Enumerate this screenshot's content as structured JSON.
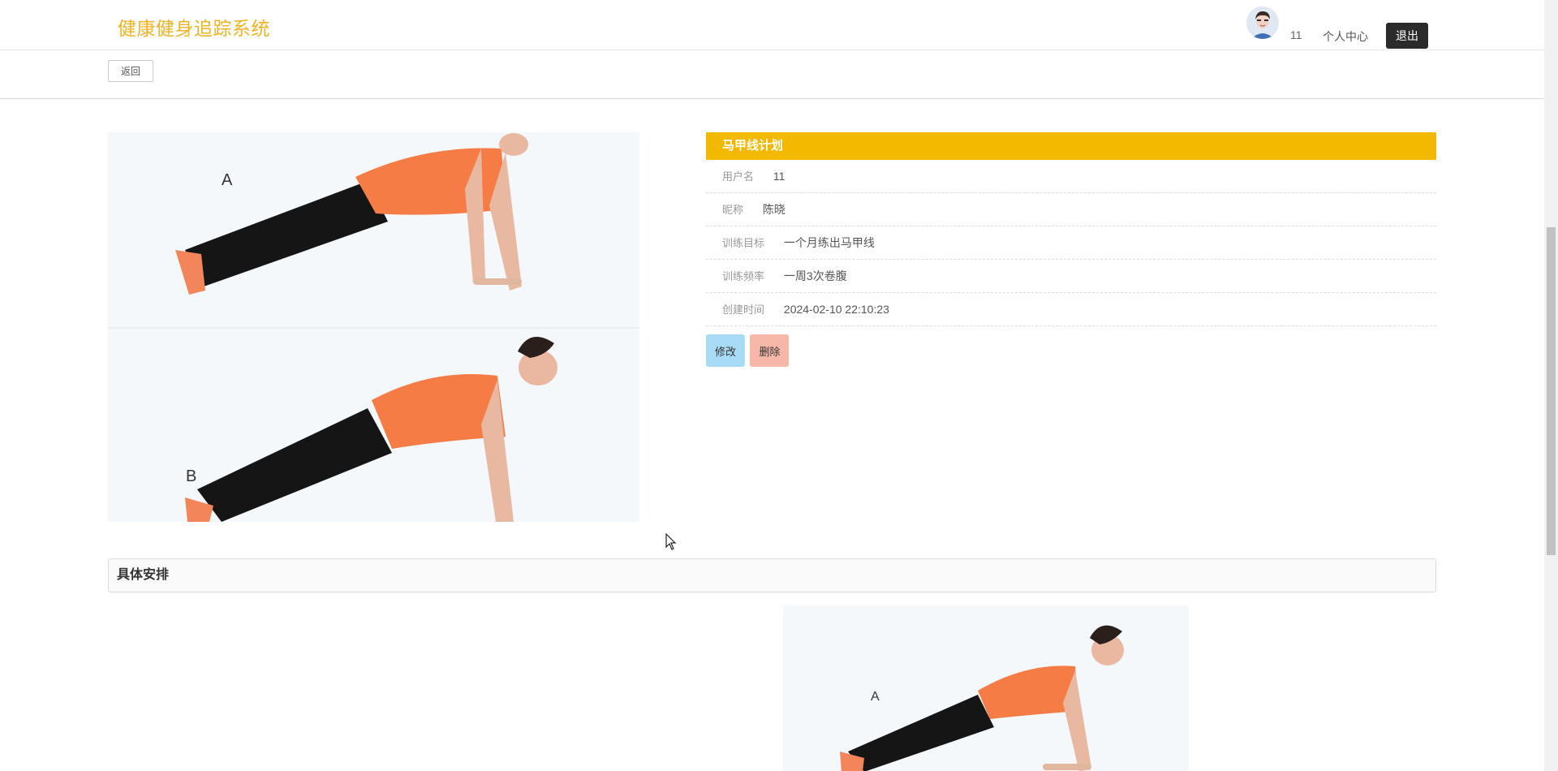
{
  "header": {
    "brand": "健康健身追踪系统",
    "username": "11",
    "personal_center": "个人中心",
    "logout": "退出"
  },
  "subbar": {
    "back": "返回"
  },
  "main_image": {
    "label_a": "A",
    "label_b": "B"
  },
  "plan": {
    "title": "马甲线计划",
    "fields": [
      {
        "label": "用户名",
        "value": "11"
      },
      {
        "label": "昵称",
        "value": "陈晓"
      },
      {
        "label": "训练目标",
        "value": "一个月练出马甲线"
      },
      {
        "label": "训练频率",
        "value": "一周3次卷腹"
      },
      {
        "label": "创建时间",
        "value": "2024-02-10 22:10:23"
      }
    ],
    "edit": "修改",
    "delete": "删除"
  },
  "schedule": {
    "heading": "具体安排",
    "label_a": "A"
  },
  "colors": {
    "brand": "#f0b322",
    "title_bar": "#f2b900",
    "edit": "#a8dcf6",
    "delete": "#f7b7a8",
    "logout": "#2b2b2b"
  }
}
